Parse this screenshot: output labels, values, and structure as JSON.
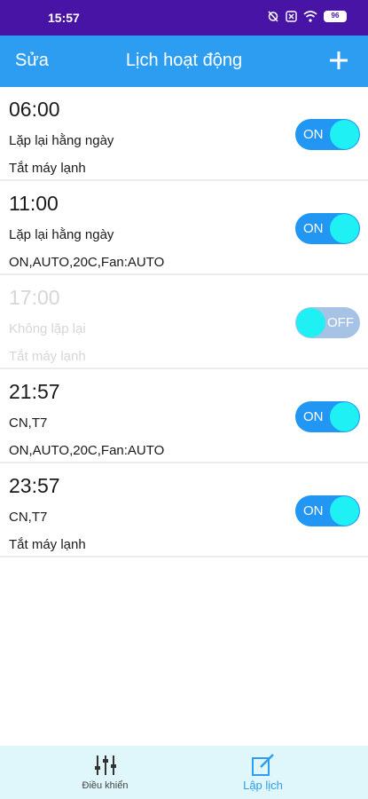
{
  "status_bar": {
    "time": "15:57",
    "battery": "96"
  },
  "header": {
    "edit_label": "Sửa",
    "title": "Lịch hoạt động",
    "add_icon": "plus-icon"
  },
  "schedules": [
    {
      "time": "06:00",
      "repeat": "Lặp lại hằng ngày",
      "action": "Tắt máy lạnh",
      "toggle": "ON",
      "enabled": true
    },
    {
      "time": "11:00",
      "repeat": "Lặp lại hằng ngày",
      "action": "ON,AUTO,20C,Fan:AUTO",
      "toggle": "ON",
      "enabled": true
    },
    {
      "time": "17:00",
      "repeat": "Không lặp lại",
      "action": "Tắt máy lạnh",
      "toggle": "OFF",
      "enabled": false
    },
    {
      "time": "21:57",
      "repeat": "CN,T7",
      "action": "ON,AUTO,20C,Fan:AUTO",
      "toggle": "ON",
      "enabled": true
    },
    {
      "time": "23:57",
      "repeat": "CN,T7",
      "action": "Tắt máy lạnh",
      "toggle": "ON",
      "enabled": true
    }
  ],
  "bottom_nav": {
    "control_label": "Điều khiển",
    "schedule_label": "Lập lịch"
  },
  "colors": {
    "status_bar": "#4814a6",
    "header": "#2d9df1",
    "toggle_on": "#2196f3",
    "knob": "#1ef0f3",
    "bottom_nav": "#dff6fb"
  }
}
